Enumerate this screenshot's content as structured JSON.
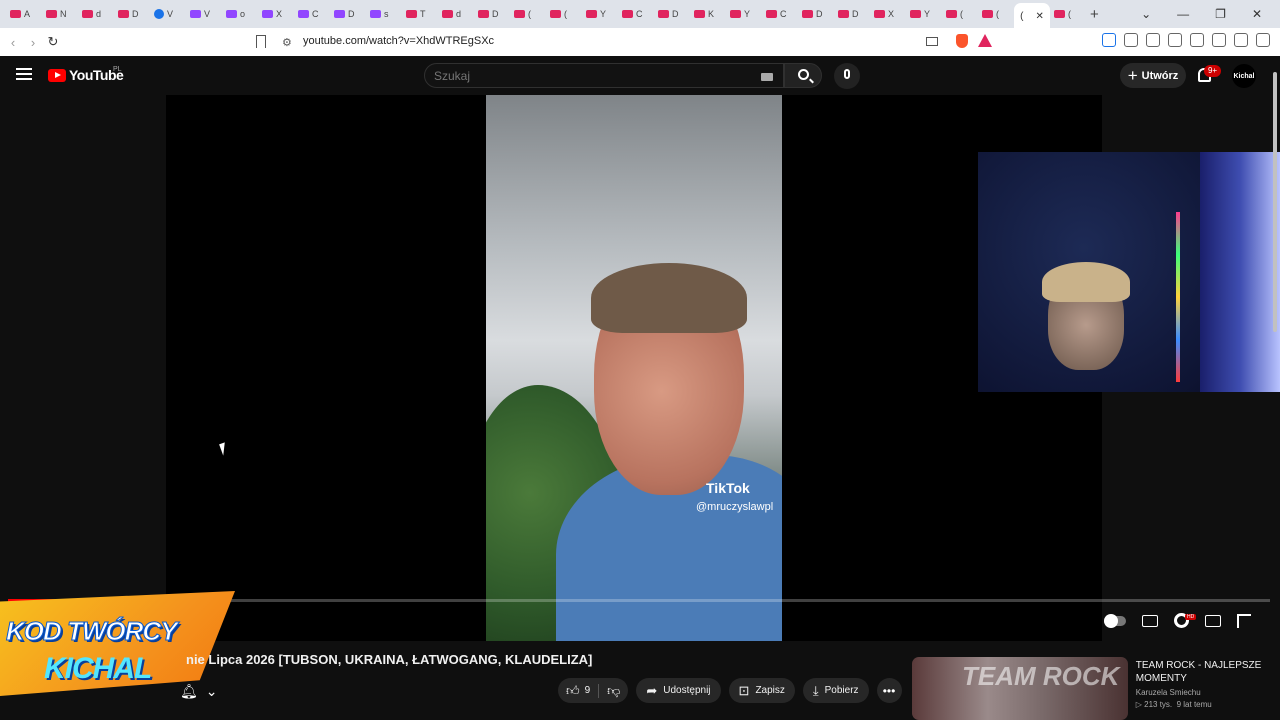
{
  "browser": {
    "tabs": [
      {
        "icon": "youtube-icon",
        "label": "A"
      },
      {
        "icon": "youtube-icon",
        "label": "N"
      },
      {
        "icon": "youtube-icon",
        "label": "d"
      },
      {
        "icon": "youtube-icon",
        "label": "D"
      },
      {
        "icon": "edge-icon",
        "label": "V"
      },
      {
        "icon": "twitch-icon",
        "label": "V"
      },
      {
        "icon": "twitch-icon",
        "label": "o"
      },
      {
        "icon": "twitch-icon",
        "label": "X"
      },
      {
        "icon": "twitch-icon",
        "label": "C"
      },
      {
        "icon": "twitch-icon",
        "label": "D"
      },
      {
        "icon": "twitch-icon",
        "label": "s"
      },
      {
        "icon": "youtube-icon",
        "label": "T"
      },
      {
        "icon": "youtube-icon",
        "label": "d"
      },
      {
        "icon": "youtube-icon",
        "label": "D"
      },
      {
        "icon": "youtube-icon",
        "label": "("
      },
      {
        "icon": "youtube-icon",
        "label": "("
      },
      {
        "icon": "youtube-icon",
        "label": "Y"
      },
      {
        "icon": "youtube-icon",
        "label": "C"
      },
      {
        "icon": "youtube-icon",
        "label": "D"
      },
      {
        "icon": "youtube-icon",
        "label": "K"
      },
      {
        "icon": "youtube-icon",
        "label": "Y"
      },
      {
        "icon": "youtube-icon",
        "label": "C"
      },
      {
        "icon": "youtube-icon",
        "label": "D"
      },
      {
        "icon": "youtube-icon",
        "label": "D"
      },
      {
        "icon": "youtube-icon",
        "label": "X"
      },
      {
        "icon": "youtube-icon",
        "label": "Y"
      },
      {
        "icon": "youtube-icon",
        "label": "("
      },
      {
        "icon": "youtube-icon",
        "label": "("
      }
    ],
    "active_tab_label": "(",
    "after_active_tab": {
      "icon": "youtube-icon",
      "label": "("
    },
    "url": "youtube.com/watch?v=XhdWTREgSXc"
  },
  "youtube": {
    "logo_text": "YouTube",
    "region": "PL",
    "search_placeholder": "Szukaj",
    "create_label": "Utwórz",
    "notification_count": "9+",
    "avatar_text": "Kichal"
  },
  "video": {
    "tiktok_label": "TikTok",
    "tiktok_user": "@mruczyslawpl",
    "progress": 0.09,
    "title": "nie Lipca 2026 [TUBSON, UKRAINA, ŁATWOGANG, KLAUDELIZA]"
  },
  "overlay": {
    "line1": "KOD TWÓRCY",
    "line2": "KICHAL"
  },
  "actions": {
    "like_count": "9",
    "share_label": "Udostępnij",
    "save_label": "Zapisz",
    "download_label": "Pobierz",
    "more_label": "•••"
  },
  "recommendation": {
    "title": "TEAM ROCK - NAJLEPSZE MOMENTY",
    "channel": "Karuzela Smiechu",
    "views": "213 tys.",
    "age": "9 lat temu",
    "thumb_text": "TEAM ROCK"
  }
}
